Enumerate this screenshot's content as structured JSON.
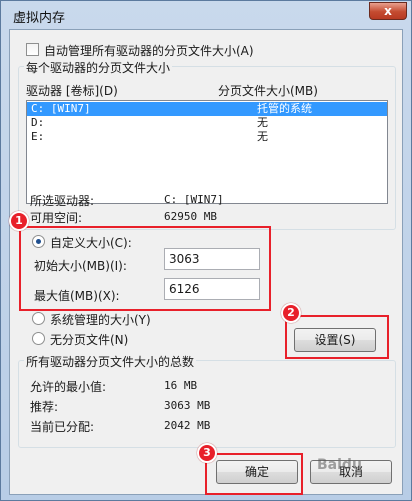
{
  "window": {
    "title": "虚拟内存",
    "close_label": "x"
  },
  "auto_manage": {
    "label": "自动管理所有驱动器的分页文件大小(A)",
    "checked": false
  },
  "drives_group": {
    "title": "每个驱动器的分页文件大小",
    "col_drive": "驱动器 [卷标](D)",
    "col_size": "分页文件大小(MB)",
    "rows": [
      {
        "drive": "C:   [WIN7]",
        "size": "托管的系统",
        "selected": true
      },
      {
        "drive": "D:",
        "size": "无",
        "selected": false
      },
      {
        "drive": "E:",
        "size": "无",
        "selected": false
      }
    ],
    "selected_drive_label": "所选驱动器:",
    "selected_drive_value": "C:  [WIN7]",
    "free_space_label": "可用空间:",
    "free_space_value": "62950 MB"
  },
  "size_options": {
    "custom_label": "自定义大小(C):",
    "initial_label": "初始大小(MB)(I):",
    "initial_value": "3063",
    "max_label": "最大值(MB)(X):",
    "max_value": "6126",
    "system_label": "系统管理的大小(Y)",
    "none_label": "无分页文件(N)",
    "selected": "custom"
  },
  "set_button": {
    "label": "设置(S)"
  },
  "totals_group": {
    "title": "所有驱动器分页文件大小的总数",
    "min_label": "允许的最小值:",
    "min_value": "16 MB",
    "recommended_label": "推荐:",
    "recommended_value": "3063 MB",
    "allocated_label": "当前已分配:",
    "allocated_value": "2042 MB"
  },
  "footer": {
    "ok_label": "确定",
    "cancel_label": "取消"
  },
  "annotations": {
    "step1": "1",
    "step2": "2",
    "step3": "3",
    "highlight_color": "#e8202a"
  },
  "watermark": "Baidu"
}
